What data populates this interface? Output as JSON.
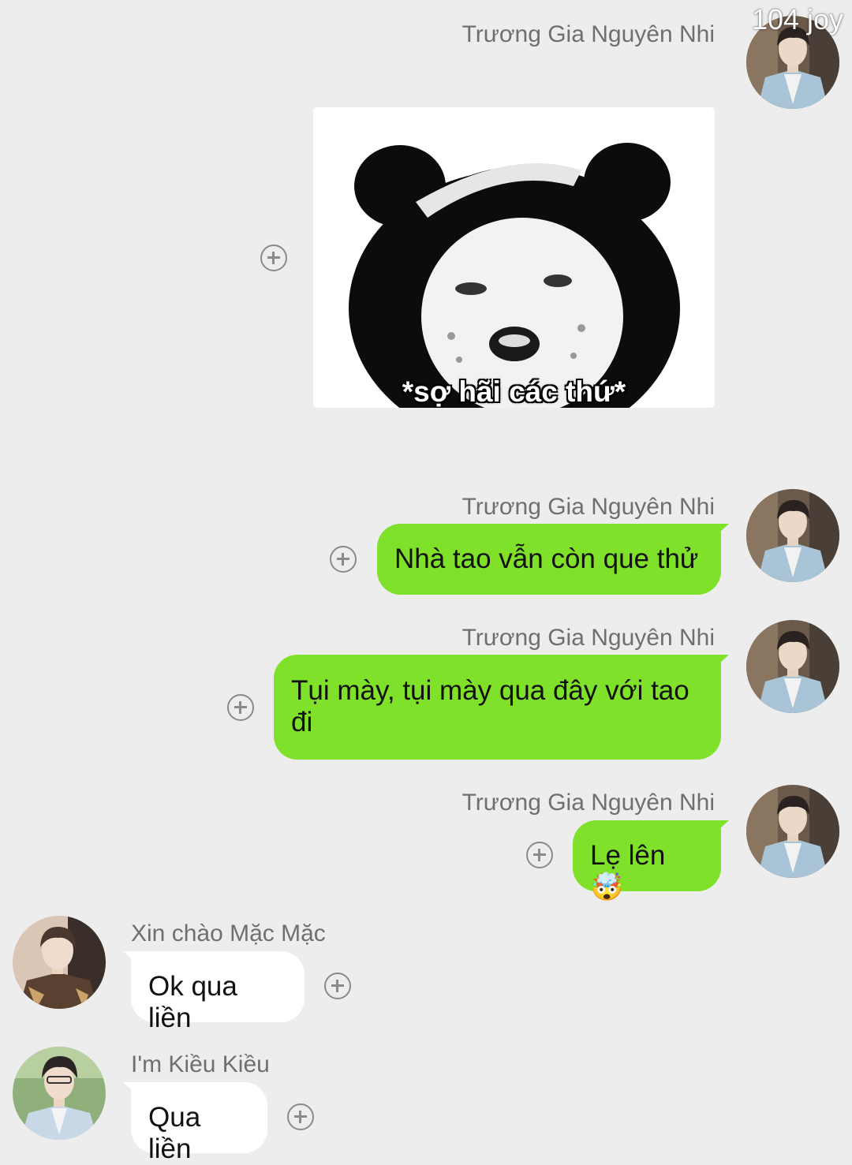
{
  "watermark": "104 joy",
  "messages": [
    {
      "sender": "Trương Gia Nguyên Nhi",
      "side": "right",
      "type": "sticker",
      "sticker_caption": "*sợ hãi các thứ*"
    },
    {
      "sender": "Trương Gia Nguyên Nhi",
      "side": "right",
      "type": "text",
      "text": "Nhà tao vẫn còn que thử"
    },
    {
      "sender": "Trương Gia Nguyên Nhi",
      "side": "right",
      "type": "text",
      "text": "Tụi mày, tụi mày qua đây với tao đi"
    },
    {
      "sender": "Trương Gia Nguyên Nhi",
      "side": "right",
      "type": "text",
      "text": "Lẹ lên",
      "emoji": "🤯"
    },
    {
      "sender": "Xin chào Mặc Mặc",
      "side": "left",
      "type": "text",
      "text": "Ok qua liền"
    },
    {
      "sender": "I'm Kiều Kiều",
      "side": "left",
      "type": "text",
      "text": "Qua liền"
    }
  ],
  "colors": {
    "background": "#ededed",
    "outgoing_bubble": "#7fe12a",
    "incoming_bubble": "#ffffff",
    "sender_name": "#6f6f6f"
  }
}
